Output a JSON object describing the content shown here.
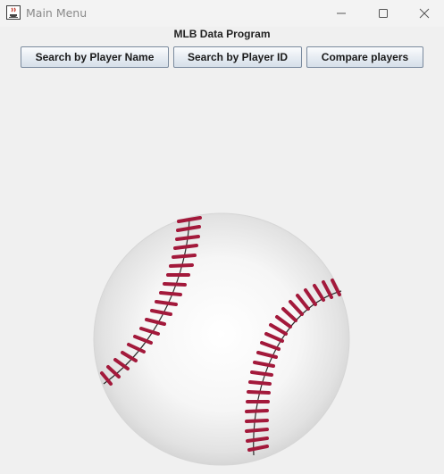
{
  "window": {
    "title": "Main Menu",
    "icons": {
      "app": "java-cup-icon",
      "minimize": "minimize-icon",
      "maximize": "maximize-icon",
      "close": "close-icon"
    }
  },
  "main": {
    "heading": "MLB Data Program",
    "buttons": {
      "search_name": "Search by Player Name",
      "search_id": "Search by Player ID",
      "compare": "Compare players"
    },
    "image": "baseball-image"
  },
  "colors": {
    "stitch": "#a3193b",
    "button_border": "#7a8a9e"
  }
}
